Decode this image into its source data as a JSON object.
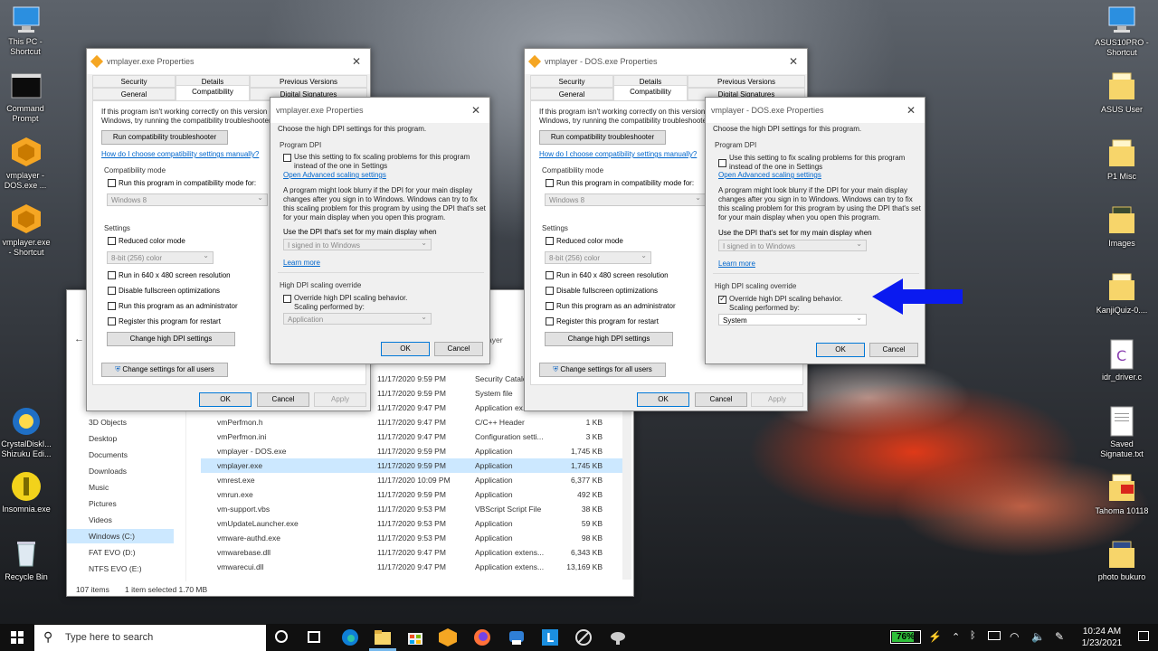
{
  "desktop": {
    "left_icons": [
      "This PC - Shortcut",
      "Command Prompt",
      "vmplayer - DOS.exe ...",
      "vmplayer.exe - Shortcut",
      "CrystalDiskI... Shizuku Edi...",
      "Insomnia.exe",
      "Recycle Bin"
    ],
    "right_icons": [
      "ASUS10PRO - Shortcut",
      "ASUS User",
      "P1 Misc",
      "Images",
      "KanjiQuiz-0....",
      "idr_driver.c",
      "Saved Signatue.txt",
      "Tahoma 10118",
      "photo bukuro"
    ]
  },
  "win_left": {
    "title": "vmplayer.exe Properties",
    "tabs": [
      "Security",
      "Details",
      "Previous Versions",
      "General",
      "Compatibility",
      "Digital Signatures"
    ],
    "intro": "If this program isn't working correctly on this version of Windows, try running the compatibility troubleshooter.",
    "troubleshoot": "Run compatibility troubleshooter",
    "how_link": "How do I choose compatibility settings manually?",
    "compat_mode": "Compatibility mode",
    "run_compat": "Run this program in compatibility mode for:",
    "os_value": "Windows 8",
    "settings": "Settings",
    "reduced": "Reduced color mode",
    "color_value": "8-bit (256) color",
    "res640": "Run in 640 x 480 screen resolution",
    "fullscreen": "Disable fullscreen optimizations",
    "admin": "Run this program as an administrator",
    "restart": "Register this program for restart",
    "hidpi_btn": "Change high DPI settings",
    "all_users": "Change settings for all users",
    "ok": "OK",
    "cancel": "Cancel",
    "apply": "Apply"
  },
  "dpi_left": {
    "title": "vmplayer.exe Properties",
    "choose": "Choose the high DPI settings for this program.",
    "program_dpi": "Program DPI",
    "use_setting": "Use this setting to fix scaling problems for this program instead of the one in Settings",
    "adv_link": "Open Advanced scaling settings",
    "para": "A program might look blurry if the DPI for your main display changes after you sign in to Windows. Windows can try to fix this scaling problem for this program by using the DPI that's set for your main display when you open this program.",
    "use_dpi": "Use the DPI that's set for my main display when",
    "signin_value": "I signed in to Windows",
    "learn": "Learn more",
    "override_section": "High DPI scaling override",
    "override": "Override high DPI scaling behavior. Scaling performed by:",
    "scaling_value": "Application",
    "ok": "OK",
    "cancel": "Cancel"
  },
  "win_right": {
    "title": "vmplayer - DOS.exe Properties"
  },
  "dpi_right": {
    "title": "vmplayer - DOS.exe Properties",
    "scaling_value": "System"
  },
  "explorer": {
    "sidebar": [
      "3D Objects",
      "Desktop",
      "Documents",
      "Downloads",
      "Music",
      "Pictures",
      "Videos",
      "Windows (C:)",
      "FAT EVO (D:)",
      "NTFS EVO (E:)"
    ],
    "header_partial": "ayer",
    "rows": [
      {
        "name": "",
        "date": "11/17/2020 9:59 PM",
        "type": "Security Catalo...",
        "size": ""
      },
      {
        "name": "",
        "date": "11/17/2020 9:59 PM",
        "type": "System file",
        "size": ""
      },
      {
        "name": "",
        "date": "11/17/2020 9:47 PM",
        "type": "Application ex...",
        "size": ""
      },
      {
        "name": "vmPerfmon.h",
        "date": "11/17/2020 9:47 PM",
        "type": "C/C++ Header",
        "size": "1 KB"
      },
      {
        "name": "vmPerfmon.ini",
        "date": "11/17/2020 9:47 PM",
        "type": "Configuration setti...",
        "size": "3 KB"
      },
      {
        "name": "vmplayer - DOS.exe",
        "date": "11/17/2020 9:59 PM",
        "type": "Application",
        "size": "1,745 KB"
      },
      {
        "name": "vmplayer.exe",
        "date": "11/17/2020 9:59 PM",
        "type": "Application",
        "size": "1,745 KB"
      },
      {
        "name": "vmrest.exe",
        "date": "11/17/2020 10:09 PM",
        "type": "Application",
        "size": "6,377 KB"
      },
      {
        "name": "vmrun.exe",
        "date": "11/17/2020 9:59 PM",
        "type": "Application",
        "size": "492 KB"
      },
      {
        "name": "vm-support.vbs",
        "date": "11/17/2020 9:53 PM",
        "type": "VBScript Script File",
        "size": "38 KB"
      },
      {
        "name": "vmUpdateLauncher.exe",
        "date": "11/17/2020 9:53 PM",
        "type": "Application",
        "size": "59 KB"
      },
      {
        "name": "vmware-authd.exe",
        "date": "11/17/2020 9:53 PM",
        "type": "Application",
        "size": "98 KB"
      },
      {
        "name": "vmwarebase.dll",
        "date": "11/17/2020 9:47 PM",
        "type": "Application extens...",
        "size": "6,343 KB"
      },
      {
        "name": "vmwarecui.dll",
        "date": "11/17/2020 9:47 PM",
        "type": "Application extens...",
        "size": "13,169 KB"
      }
    ],
    "status_items": "107 items",
    "status_selected": "1 item selected  1.70 MB"
  },
  "taskbar": {
    "search_placeholder": "Type here to search",
    "battery": "76%",
    "time": "10:24 AM",
    "date": "1/23/2021"
  }
}
